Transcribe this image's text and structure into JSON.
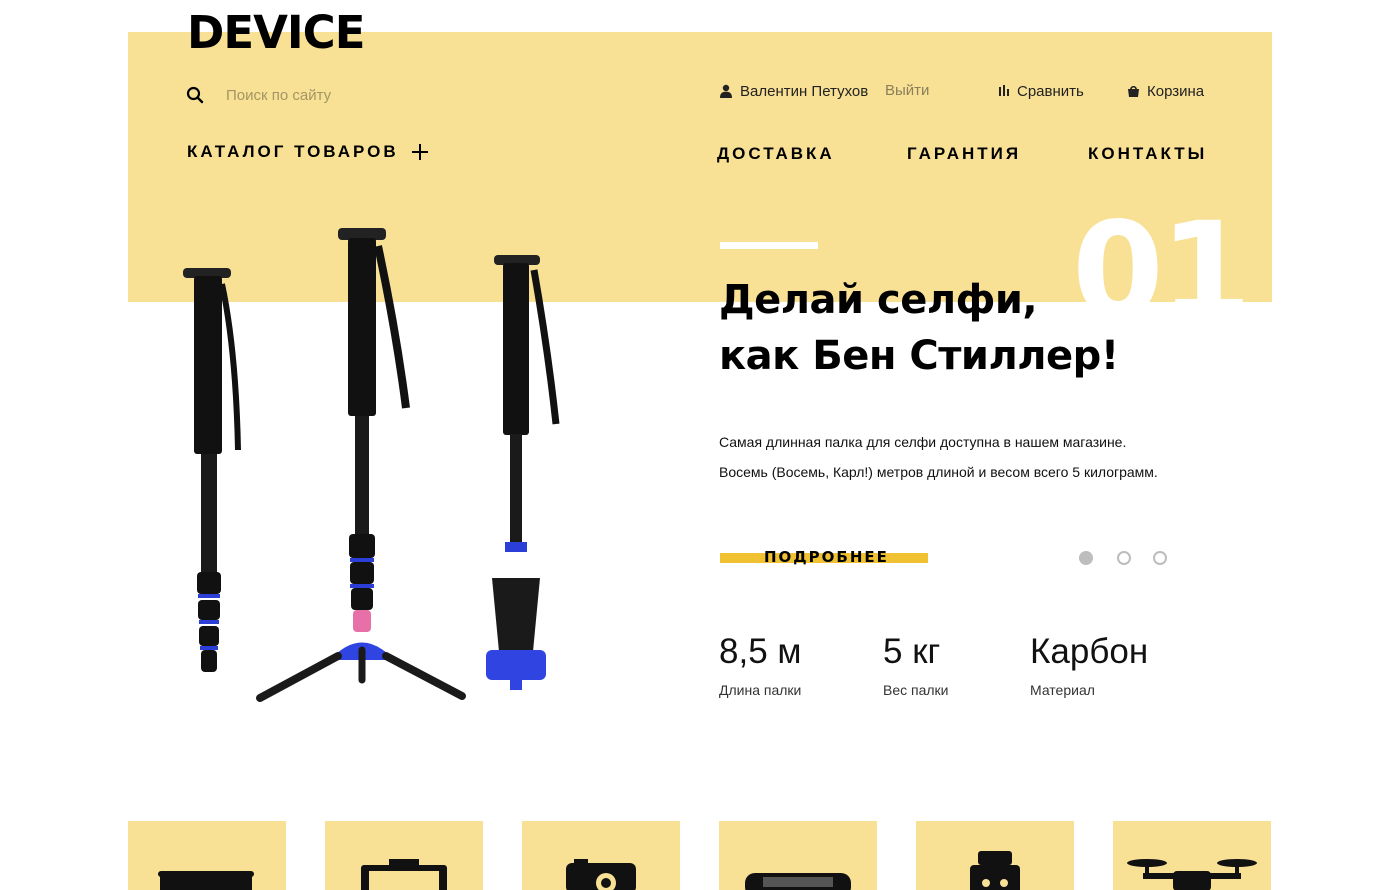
{
  "header": {
    "logo": "DEVICE",
    "search": {
      "placeholder": "Поиск по сайту",
      "icon": "search-icon"
    },
    "user": {
      "name": "Валентин Петухов",
      "logout": "Выйти"
    },
    "compare": "Сравнить",
    "cart": "Корзина"
  },
  "nav": {
    "catalog": "КАТАЛОГ ТОВАРОВ",
    "links": [
      "ДОСТАВКА",
      "ГАРАНТИЯ",
      "КОНТАКТЫ"
    ]
  },
  "slide": {
    "number": "01",
    "title_lines": [
      "Делай селфи,",
      "как Бен Стиллер!"
    ],
    "desc_lines": [
      "Самая длинная палка для селфи доступна в нашем магазине.",
      "Восемь (Восемь, Карл!) метров длиной и весом всего 5 килограмм."
    ],
    "more_label": "ПОДРОБНЕЕ",
    "pager": {
      "total": 3,
      "active": 1
    },
    "stats": [
      {
        "value": "8,5 м",
        "label": "Длина палки"
      },
      {
        "value": "5 кг",
        "label": "Вес палки"
      },
      {
        "value": "Карбон",
        "label": "Материал"
      }
    ]
  },
  "categories": [
    {
      "icon": "vr-headset-icon"
    },
    {
      "icon": "tablet-icon"
    },
    {
      "icon": "action-camera-icon"
    },
    {
      "icon": "gamepad-icon"
    },
    {
      "icon": "robot-icon"
    },
    {
      "icon": "drone-icon"
    }
  ],
  "colors": {
    "accent_band": "#f8e195",
    "button_accent": "#f0c232",
    "dot_inactive": "#bdbdbd"
  }
}
